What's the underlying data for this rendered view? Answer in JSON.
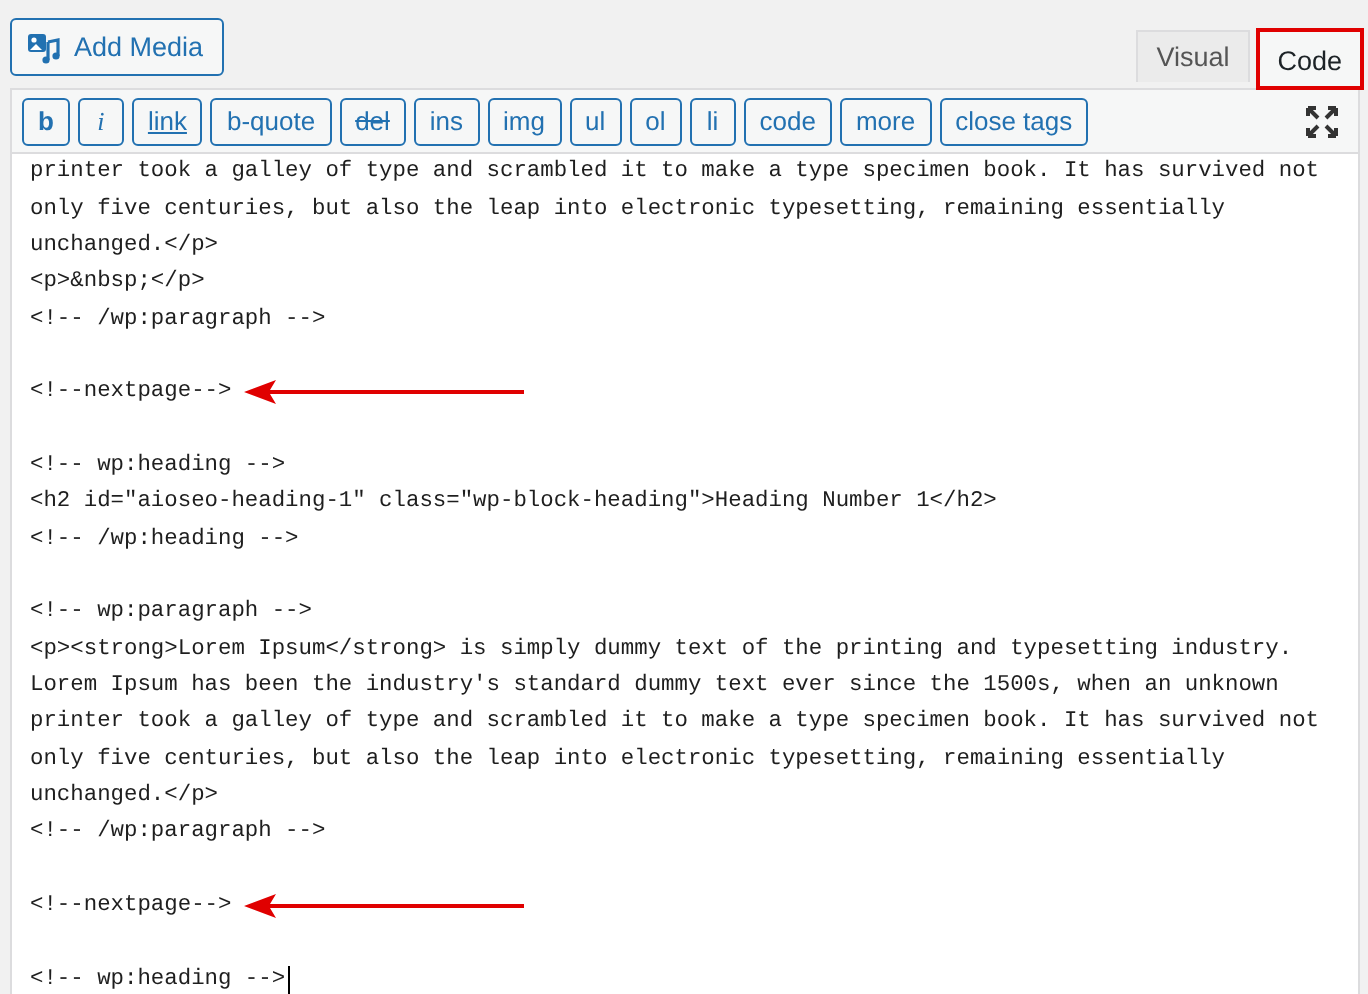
{
  "media_button": {
    "label": "Add Media"
  },
  "tabs": [
    {
      "label": "Visual",
      "selected": false,
      "highlighted": false
    },
    {
      "label": "Code",
      "selected": true,
      "highlighted": true
    }
  ],
  "toolbar": [
    {
      "label": "b",
      "kind": "bold"
    },
    {
      "label": "i",
      "kind": "italic"
    },
    {
      "label": "link",
      "kind": "underline"
    },
    {
      "label": "b-quote",
      "kind": "plain"
    },
    {
      "label": "del",
      "kind": "strike"
    },
    {
      "label": "ins",
      "kind": "plain"
    },
    {
      "label": "img",
      "kind": "plain"
    },
    {
      "label": "ul",
      "kind": "plain"
    },
    {
      "label": "ol",
      "kind": "plain"
    },
    {
      "label": "li",
      "kind": "plain"
    },
    {
      "label": "code",
      "kind": "plain"
    },
    {
      "label": "more",
      "kind": "plain"
    },
    {
      "label": "close tags",
      "kind": "plain"
    }
  ],
  "lines": [
    {
      "kind": "code",
      "text": "printer took a galley of type and scrambled it to make a type specimen book. It has survived not",
      "arrow": false
    },
    {
      "kind": "code",
      "text": "only five centuries, but also the leap into electronic typesetting, remaining essentially",
      "arrow": false
    },
    {
      "kind": "code",
      "text": "unchanged.</p>",
      "arrow": false
    },
    {
      "kind": "code",
      "text": "<p>&nbsp;</p>",
      "arrow": false
    },
    {
      "kind": "code",
      "text": "<!-- /wp:paragraph -->",
      "arrow": false
    },
    {
      "kind": "blank"
    },
    {
      "kind": "code",
      "text": "<!--nextpage-->",
      "arrow": true
    },
    {
      "kind": "blank"
    },
    {
      "kind": "code",
      "text": "<!-- wp:heading -->",
      "arrow": false
    },
    {
      "kind": "code",
      "text": "<h2 id=\"aioseo-heading-1\" class=\"wp-block-heading\">Heading Number 1</h2>",
      "arrow": false
    },
    {
      "kind": "code",
      "text": "<!-- /wp:heading -->",
      "arrow": false
    },
    {
      "kind": "blank"
    },
    {
      "kind": "code",
      "text": "<!-- wp:paragraph -->",
      "arrow": false
    },
    {
      "kind": "code",
      "text": "<p><strong>Lorem Ipsum</strong> is simply dummy text of the printing and typesetting industry.",
      "arrow": false
    },
    {
      "kind": "code",
      "text": "Lorem Ipsum has been the industry's standard dummy text ever since the 1500s, when an unknown",
      "arrow": false
    },
    {
      "kind": "code",
      "text": "printer took a galley of type and scrambled it to make a type specimen book. It has survived not",
      "arrow": false
    },
    {
      "kind": "code",
      "text": "only five centuries, but also the leap into electronic typesetting, remaining essentially",
      "arrow": false
    },
    {
      "kind": "code",
      "text": "unchanged.</p>",
      "arrow": false
    },
    {
      "kind": "code",
      "text": "<!-- /wp:paragraph -->",
      "arrow": false
    },
    {
      "kind": "blank"
    },
    {
      "kind": "code",
      "text": "<!--nextpage-->",
      "arrow": true
    },
    {
      "kind": "blank"
    },
    {
      "kind": "code",
      "text": "<!-- wp:heading -->",
      "arrow": false,
      "cursor": true
    }
  ]
}
